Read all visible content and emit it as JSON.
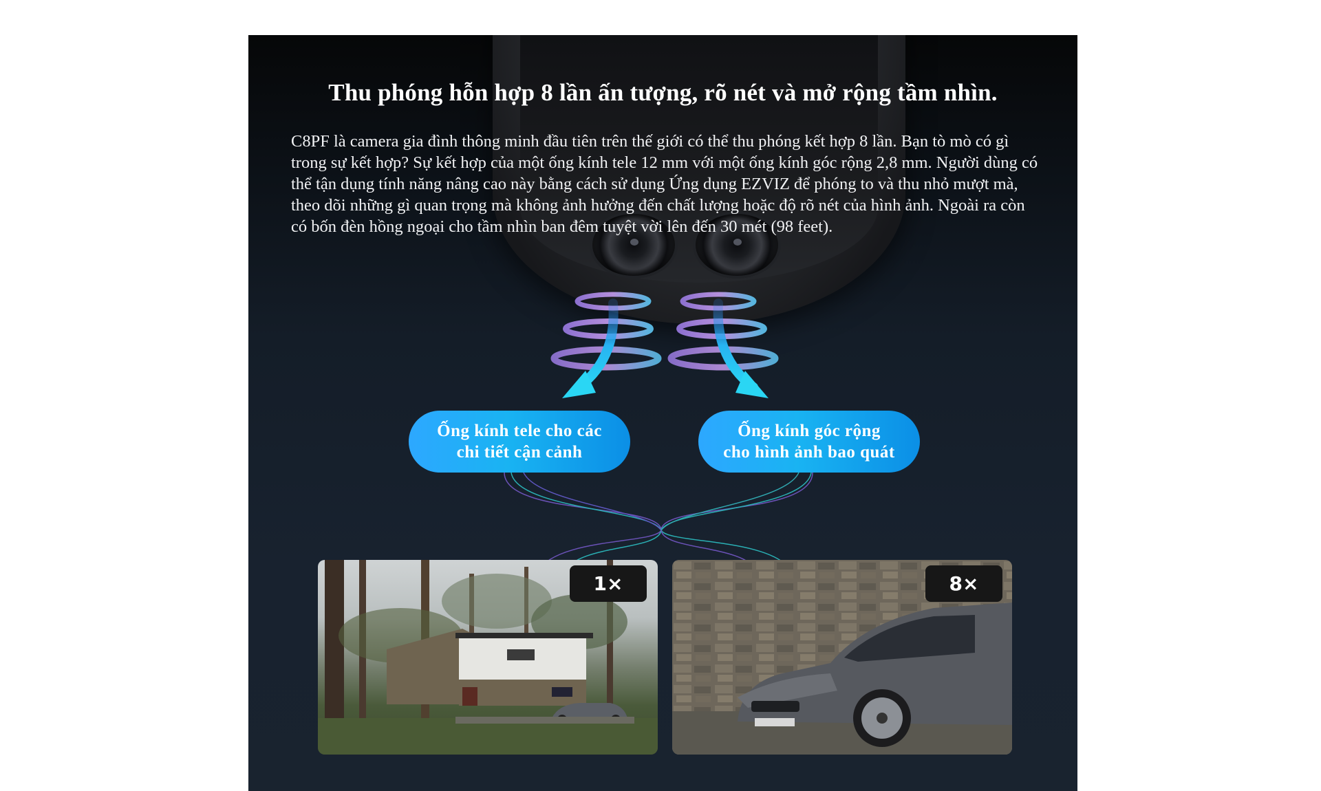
{
  "section": {
    "title": "Thu phóng hỗn hợp 8 lần ấn tượng, rõ nét và mở rộng tầm nhìn.",
    "description": "C8PF là camera gia đình thông minh đầu tiên trên thế giới có thể thu phóng kết hợp 8 lần. Bạn tò mò có gì trong sự kết hợp? Sự kết hợp của một ống kính tele 12 mm với một ống kính góc rộng 2,8 mm. Người dùng có thể tận dụng tính năng nâng cao này bằng cách sử dụng Ứng dụng EZVIZ để phóng to và thu nhỏ mượt mà, theo dõi những gì quan trọng mà không ảnh hưởng đến chất lượng hoặc độ rõ nét của hình ảnh. Ngoài ra còn có bốn đèn hồng ngoại cho tầm nhìn ban đêm tuyệt vời lên đến 30 mét (98 feet)."
  },
  "lens_labels": {
    "tele": "Ống kính tele cho các\nchi tiết cận cảnh",
    "wide": "Ống kính góc rộng\ncho hình ảnh bao quát"
  },
  "zoom_badges": {
    "wide_view": "1×",
    "tele_view": "8×"
  },
  "colors": {
    "panel_bg": "#141d28",
    "pill_gradient_start": "#2da8ff",
    "pill_gradient_end": "#0b8fe6",
    "arrow": "#22c4f0",
    "ring_purple": "#b07be0",
    "badge_bg": "#171717"
  }
}
